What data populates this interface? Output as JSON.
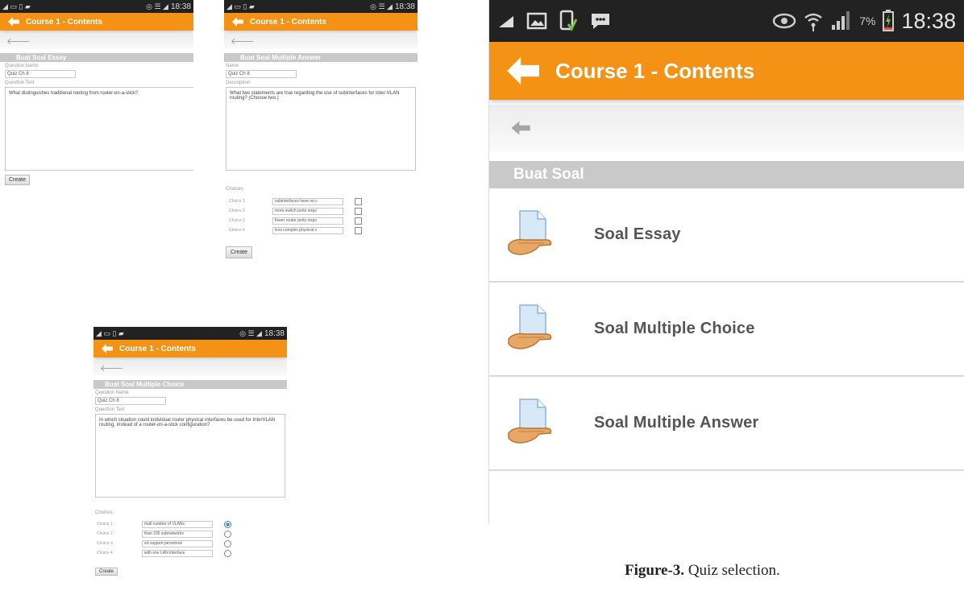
{
  "status_bar": {
    "time": "18:38",
    "battery": "7%"
  },
  "app_bar": {
    "title": "Course 1 - Contents"
  },
  "screen_essay": {
    "section": "Buat Soal Essay",
    "name_label": "Question Name",
    "name_value": "Quiz Ch 8",
    "text_label": "Question Text",
    "text_value": "What distinguishes traditional routing from router-on-a-stick?",
    "create": "Create"
  },
  "screen_multi_answer": {
    "section": "Buat Soal Multiple Answer",
    "name_label": "Name",
    "name_value": "Quiz Ch 8",
    "text_label": "Description",
    "text_value": "What two statements are true regarding the use of subinterfaces for inter-VLAN routing? (Choose two.)",
    "choices_label": "Choices",
    "choices": [
      {
        "label": "Choice 1",
        "value": "subinterfaces have no c"
      },
      {
        "label": "Choice 2",
        "value": "more switch ports requi"
      },
      {
        "label": "Choice 3",
        "value": "fewer router ports requi"
      },
      {
        "label": "Choice 4",
        "value": "less complex physical c"
      }
    ],
    "create": "Create"
  },
  "screen_multi_choice": {
    "section": "Buat Soal Multiple Choice",
    "name_label": "Question Name",
    "name_value": "Quiz Ch 8",
    "text_label": "Question Text",
    "text_value": "In which situation could individual router physical interfaces be used for InterVLAN routing, instead of a router-on-a-stick configuration?",
    "choices_label": "Choices",
    "choices": [
      {
        "label": "Choice 1",
        "value": "mall number of VLANs",
        "selected": true
      },
      {
        "label": "Choice 2",
        "value": "than 100 subnetworks",
        "selected": false
      },
      {
        "label": "Choice 3",
        "value": "ed support personnel",
        "selected": false
      },
      {
        "label": "Choice 4",
        "value": "with one LAN interface",
        "selected": false
      }
    ],
    "create": "Create"
  },
  "screen_select": {
    "section": "Buat Soal",
    "items": [
      {
        "label": "Soal Essay",
        "icon": "document-hand-icon"
      },
      {
        "label": "Soal Multiple Choice",
        "icon": "document-hand-icon"
      },
      {
        "label": "Soal Multiple Answer",
        "icon": "document-hand-icon"
      }
    ]
  },
  "caption": {
    "bold": "Figure-3.",
    "text": " Quiz selection."
  },
  "colors": {
    "accent": "#f39215",
    "status_bar": "#222222",
    "section": "#c9c9c9"
  }
}
